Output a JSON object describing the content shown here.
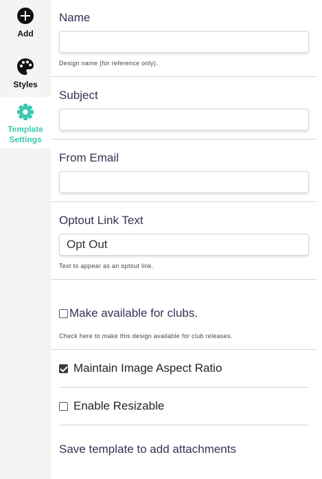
{
  "sidebar": {
    "items": [
      {
        "label": "Add",
        "icon": "plus-circle-icon"
      },
      {
        "label": "Styles",
        "icon": "palette-icon"
      },
      {
        "label_line1": "Template",
        "label_line2": "Settings",
        "icon": "gear-icon",
        "active": true
      }
    ],
    "active_color": "#3ec9b0"
  },
  "form": {
    "name": {
      "label": "Name",
      "value": "",
      "help": "Design name (for reference only)."
    },
    "subject": {
      "label": "Subject",
      "value": ""
    },
    "from_email": {
      "label": "From Email",
      "value": ""
    },
    "optout": {
      "label": "Optout Link Text",
      "value": "Opt Out",
      "help": "Text to appear as an optout link."
    },
    "clubs": {
      "label": "Make available for clubs.",
      "checked": false,
      "help": "Check here to make this design available for club releases."
    },
    "aspect": {
      "label": "Maintain Image Aspect Ratio",
      "checked": true
    },
    "resizable": {
      "label": "Enable Resizable",
      "checked": false
    },
    "attachments_note": "Save template to add attachments"
  },
  "colors": {
    "label_text": "#3b2e55",
    "sidebar_bg": "#f4f4f2"
  }
}
